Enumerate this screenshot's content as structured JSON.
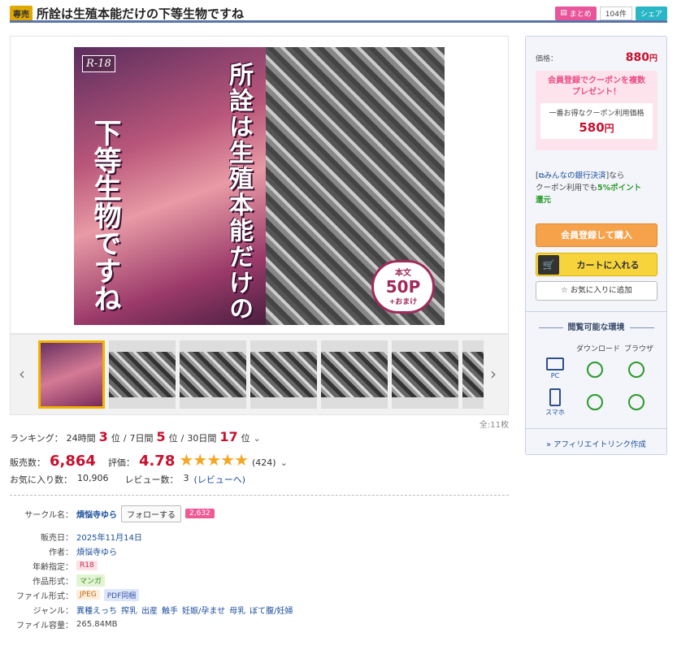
{
  "header": {
    "badge": "専売",
    "title": "所詮は生殖本能だけの下等生物ですね",
    "matome_label": "まとめ",
    "matome_count": "104件",
    "share_label": "シェア"
  },
  "cover": {
    "rating_mark": "R-18",
    "title_upper": "所詮は生殖本能だけの",
    "title_lower": "下等生物ですね",
    "page_badge_a": "本文",
    "page_badge_b": "50P",
    "page_badge_c": "+おまけ"
  },
  "gallery": {
    "prev_icon": "‹",
    "next_icon": "›",
    "total": "全:11枚"
  },
  "ranking": {
    "label": "ランキング：",
    "p24_label": "24時間",
    "p24_value": "3",
    "p7_label": "7日間",
    "p7_value": "5",
    "p30_label": "30日間",
    "p30_value": "17",
    "unit": "位",
    "sep": "/"
  },
  "sales": {
    "label": "販売数：",
    "value": "6,864",
    "rating_label": "評価：",
    "rating_value": "4.78",
    "stars": "★★★★★",
    "rating_fraction": 0.956,
    "review_count": "(424)"
  },
  "favs": {
    "fav_label": "お気に入り数：",
    "fav_value": "10,906",
    "review_label": "レビュー数：",
    "review_value": "3",
    "review_link": "(レビューへ)"
  },
  "info": {
    "circle_label": "サークル名：",
    "circle_name": "煩悩寺ゆら",
    "follow_label": "フォローする",
    "follow_count": "2,632",
    "date_label": "販売日：",
    "date_value": "2025年11月14日",
    "author_label": "作者：",
    "author_value": "煩悩寺ゆら",
    "age_label": "年齢指定：",
    "age_value": "R18",
    "format_label": "作品形式：",
    "format_value": "マンガ",
    "file_label": "ファイル形式：",
    "file_value1": "JPEG",
    "file_value2": "PDF同梱",
    "genre_label": "ジャンル：",
    "genres": [
      "異種えっち",
      "搾乳",
      "出産",
      "触手",
      "妊娠/孕ませ",
      "母乳",
      "ぼて腹/妊婦"
    ],
    "size_label": "ファイル容量：",
    "size_value": "265.84MB"
  },
  "side": {
    "price_label": "価格：",
    "price_value": "880",
    "yen": "円",
    "coupon_msg1": "会員登録でクーポンを複数",
    "coupon_msg2": "プレゼント！",
    "coupon_label": "一番お得なクーポン利用価格",
    "coupon_price": "580",
    "bank_pre": "[",
    "bank_name": "みんなの銀行決済",
    "bank_post": "]なら",
    "bank_line2": "クーポン利用でも",
    "bank_pct": "5%ポイント",
    "bank_line3": "還元",
    "buy_label": "会員登録して購入",
    "cart_label": "カートに入れる",
    "fav_label": "お気に入りに追加",
    "env_title": "閲覧可能な環境",
    "env_download": "ダウンロード",
    "env_browser": "ブラウザ",
    "env_pc": "PC",
    "env_sp": "スマホ",
    "affiliate_label": "アフィリエイトリンク作成"
  },
  "colors": {
    "accent_blue": "#5a73a8",
    "price_red": "#c8102e",
    "buy_orange": "#f5a24b",
    "cart_yellow": "#f7d33c",
    "ok_green": "#2a9a2a"
  }
}
